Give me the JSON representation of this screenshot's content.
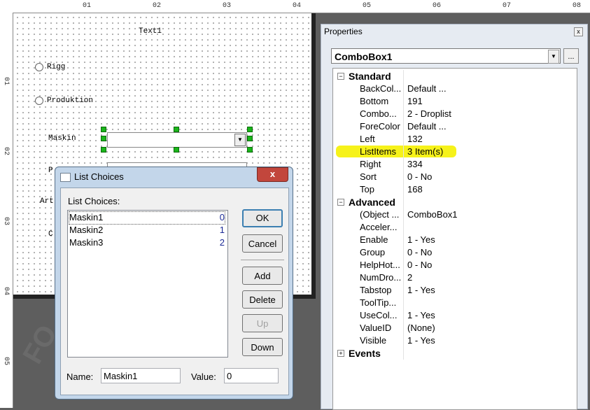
{
  "designer": {
    "ruler_top": [
      "01",
      "02",
      "03",
      "04",
      "05",
      "06",
      "07",
      "08"
    ],
    "ruler_left": [
      "01",
      "02",
      "03",
      "04",
      "05"
    ],
    "labels": {
      "text1": "Text1",
      "radio_rigg": "Rigg",
      "radio_produktion": "Produktion",
      "maskin": "Maskin",
      "partial_p": "P",
      "partial_art": "Art",
      "partial_c": "C"
    },
    "combo_arrow": "▼"
  },
  "properties": {
    "title": "Properties",
    "close_glyph": "x",
    "object": "ComboBox1",
    "object_arrow": "▼",
    "object_button": "...",
    "categories": {
      "standard": {
        "toggle": "−",
        "label": "Standard"
      },
      "advanced": {
        "toggle": "−",
        "label": "Advanced"
      },
      "events": {
        "toggle": "+",
        "label": "Events"
      }
    },
    "standard_rows": [
      {
        "name": "BackCol...",
        "value": "Default ..."
      },
      {
        "name": "Bottom",
        "value": "191"
      },
      {
        "name": "Combo...",
        "value": "2 - Droplist"
      },
      {
        "name": "ForeColor",
        "value": "Default ..."
      },
      {
        "name": "Left",
        "value": "132"
      },
      {
        "name": "ListItems",
        "value": "3 Item(s)"
      },
      {
        "name": "Right",
        "value": "334"
      },
      {
        "name": "Sort",
        "value": "0 - No"
      },
      {
        "name": "Top",
        "value": "168"
      }
    ],
    "advanced_rows": [
      {
        "name": "(Object ...",
        "value": "ComboBox1"
      },
      {
        "name": "Acceler...",
        "value": ""
      },
      {
        "name": "Enable",
        "value": "1 - Yes"
      },
      {
        "name": "Group",
        "value": "0 - No"
      },
      {
        "name": "HelpHot...",
        "value": "0 - No"
      },
      {
        "name": "NumDro...",
        "value": "2"
      },
      {
        "name": "Tabstop",
        "value": "1 - Yes"
      },
      {
        "name": "ToolTip...",
        "value": ""
      },
      {
        "name": "UseCol...",
        "value": "1 - Yes"
      },
      {
        "name": "ValueID",
        "value": "(None)"
      },
      {
        "name": "Visible",
        "value": "1 - Yes"
      }
    ],
    "highlight_color": "#f6f21a"
  },
  "dialog": {
    "title": "List Choices",
    "close_glyph": "x",
    "list_label": "List Choices:",
    "items": [
      {
        "name": "Maskin1",
        "value": "0"
      },
      {
        "name": "Maskin2",
        "value": "1"
      },
      {
        "name": "Maskin3",
        "value": "2"
      }
    ],
    "buttons": {
      "ok": "OK",
      "cancel": "Cancel",
      "add": "Add",
      "delete": "Delete",
      "up": "Up",
      "down": "Down"
    },
    "name_label": "Name:",
    "name_value": "Maskin1",
    "value_label": "Value:",
    "value_value": "0"
  }
}
